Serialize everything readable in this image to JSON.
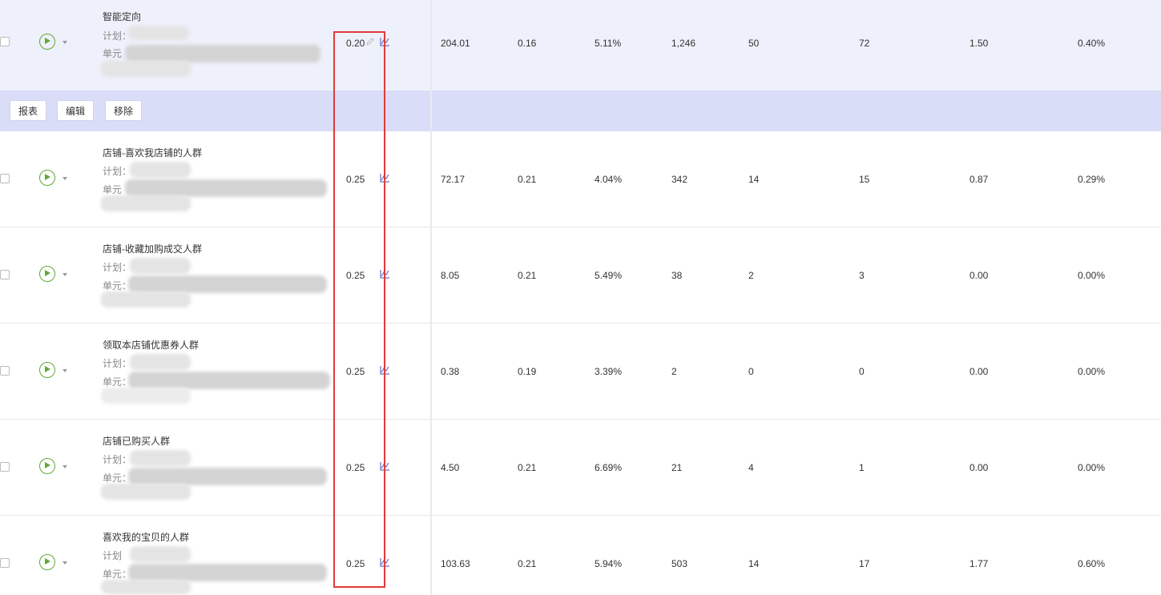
{
  "colors": {
    "accent_green": "#62a832",
    "highlight_row": "#eef0fb",
    "action_bar": "#d9ddf7",
    "annotation_red": "#e23a3a",
    "chart_icon": "#6b6fc5"
  },
  "action_bar": {
    "report_label": "报表",
    "edit_label": "编辑",
    "remove_label": "移除"
  },
  "labels": {
    "plan": "计划：",
    "unit_plain": "单元",
    "unit_colon": "单元："
  },
  "icons": {
    "play": "play-circle-icon",
    "caret": "chevron-down-icon",
    "chart": "trend-chart-icon",
    "edit": "pencil-icon"
  },
  "rows": [
    {
      "name": "智能定向",
      "plan_label": "计划：",
      "unit_label": "单元",
      "bid": "0.20",
      "v1": "204.01",
      "v2": "0.16",
      "v3": "5.11%",
      "v4": "1,246",
      "v5": "50",
      "v6": "72",
      "v7": "1.50",
      "v8": "0.40%"
    },
    {
      "name": "店铺-喜欢我店铺的人群",
      "plan_label": "计划：",
      "unit_label": "单元",
      "bid": "0.25",
      "v1": "72.17",
      "v2": "0.21",
      "v3": "4.04%",
      "v4": "342",
      "v5": "14",
      "v6": "15",
      "v7": "0.87",
      "v8": "0.29%"
    },
    {
      "name": "店铺-收藏加购成交人群",
      "plan_label": "计划：",
      "unit_label": "单元：",
      "bid": "0.25",
      "v1": "8.05",
      "v2": "0.21",
      "v3": "5.49%",
      "v4": "38",
      "v5": "2",
      "v6": "3",
      "v7": "0.00",
      "v8": "0.00%"
    },
    {
      "name": "领取本店铺优惠券人群",
      "plan_label": "计划：",
      "unit_label": "单元：",
      "bid": "0.25",
      "v1": "0.38",
      "v2": "0.19",
      "v3": "3.39%",
      "v4": "2",
      "v5": "0",
      "v6": "0",
      "v7": "0.00",
      "v8": "0.00%"
    },
    {
      "name": "店铺已购买人群",
      "plan_label": "计划：",
      "unit_label": "单元：",
      "bid": "0.25",
      "v1": "4.50",
      "v2": "0.21",
      "v3": "6.69%",
      "v4": "21",
      "v5": "4",
      "v6": "1",
      "v7": "0.00",
      "v8": "0.00%"
    },
    {
      "name": "喜欢我的宝贝的人群",
      "plan_label": "计划",
      "unit_label": "单元：",
      "bid": "0.25",
      "v1": "103.63",
      "v2": "0.21",
      "v3": "5.94%",
      "v4": "503",
      "v5": "14",
      "v6": "17",
      "v7": "1.77",
      "v8": "0.60%"
    }
  ]
}
